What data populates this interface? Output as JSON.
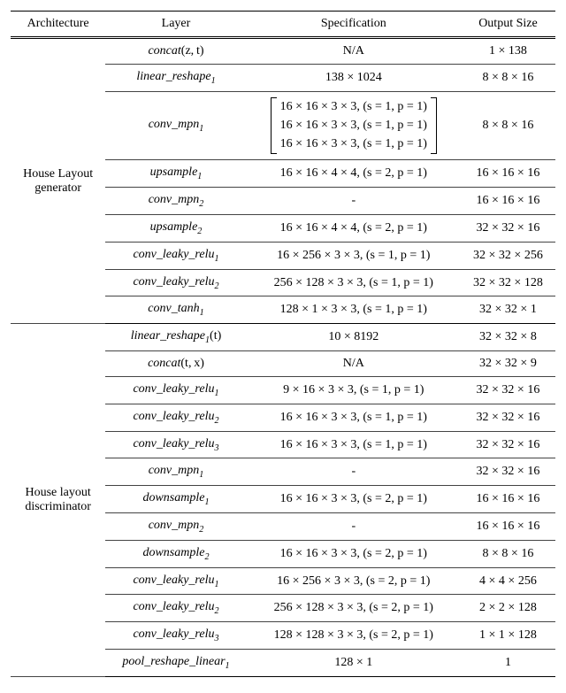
{
  "headers": {
    "arch": "Architecture",
    "layer": "Layer",
    "spec": "Specification",
    "out": "Output Size"
  },
  "sections": [
    {
      "arch": "House Layout\ngenerator",
      "rows": [
        {
          "layer_base": "concat",
          "layer_sub": "",
          "layer_args": "(z, t)",
          "spec": "N/A",
          "out": "1 × 138"
        },
        {
          "layer_base": "linear_reshape",
          "layer_sub": "1",
          "layer_args": "",
          "spec": "138 × 1024",
          "out": "8 × 8 × 16"
        },
        {
          "layer_base": "conv_mpn",
          "layer_sub": "1",
          "layer_args": "",
          "spec_bracket": [
            "16 × 16 × 3 × 3, (s = 1, p = 1)",
            "16 × 16 × 3 × 3, (s = 1, p = 1)",
            "16 × 16 × 3 × 3, (s = 1, p = 1)"
          ],
          "out": "8 × 8 × 16"
        },
        {
          "layer_base": "upsample",
          "layer_sub": "1",
          "layer_args": "",
          "spec": "16 × 16 × 4 × 4, (s = 2, p = 1)",
          "out": "16 × 16 × 16"
        },
        {
          "layer_base": "conv_mpn",
          "layer_sub": "2",
          "layer_args": "",
          "spec": "-",
          "out": "16 × 16 × 16"
        },
        {
          "layer_base": "upsample",
          "layer_sub": "2",
          "layer_args": "",
          "spec": "16 × 16 × 4 × 4, (s = 2, p = 1)",
          "out": "32 × 32 × 16"
        },
        {
          "layer_base": "conv_leaky_relu",
          "layer_sub": "1",
          "layer_args": "",
          "spec": "16 × 256 × 3 × 3, (s = 1, p = 1)",
          "out": "32 × 32 × 256"
        },
        {
          "layer_base": "conv_leaky_relu",
          "layer_sub": "2",
          "layer_args": "",
          "spec": "256 × 128 × 3 × 3, (s = 1, p = 1)",
          "out": "32 × 32 × 128"
        },
        {
          "layer_base": "conv_tanh",
          "layer_sub": "1",
          "layer_args": "",
          "spec": "128 × 1 × 3 × 3, (s = 1, p = 1)",
          "out": "32 × 32 × 1"
        }
      ]
    },
    {
      "arch": "House layout\ndiscriminator",
      "rows": [
        {
          "layer_base": "linear_reshape",
          "layer_sub": "1",
          "layer_args": "(t)",
          "spec": "10 × 8192",
          "out": "32 × 32 × 8"
        },
        {
          "layer_base": "concat",
          "layer_sub": "",
          "layer_args": "(t, x)",
          "spec": "N/A",
          "out": "32 × 32 × 9"
        },
        {
          "layer_base": "conv_leaky_relu",
          "layer_sub": "1",
          "layer_args": "",
          "spec": "9 × 16 × 3 × 3, (s = 1, p = 1)",
          "out": "32 × 32 × 16"
        },
        {
          "layer_base": "conv_leaky_relu",
          "layer_sub": "2",
          "layer_args": "",
          "spec": "16 × 16 × 3 × 3, (s = 1, p = 1)",
          "out": "32 × 32 × 16"
        },
        {
          "layer_base": "conv_leaky_relu",
          "layer_sub": "3",
          "layer_args": "",
          "spec": "16 × 16 × 3 × 3, (s = 1, p = 1)",
          "out": "32 × 32 × 16"
        },
        {
          "layer_base": "conv_mpn",
          "layer_sub": "1",
          "layer_args": "",
          "spec": "-",
          "out": "32 × 32 × 16"
        },
        {
          "layer_base": "downsample",
          "layer_sub": "1",
          "layer_args": "",
          "spec": "16 × 16 × 3 × 3, (s = 2, p = 1)",
          "out": "16 × 16 × 16"
        },
        {
          "layer_base": "conv_mpn",
          "layer_sub": "2",
          "layer_args": "",
          "spec": "-",
          "out": "16 × 16 × 16"
        },
        {
          "layer_base": "downsample",
          "layer_sub": "2",
          "layer_args": "",
          "spec": "16 × 16 × 3 × 3, (s = 2, p = 1)",
          "out": "8 × 8 × 16"
        },
        {
          "layer_base": "conv_leaky_relu",
          "layer_sub": "1",
          "layer_args": "",
          "spec": "16 × 256 × 3 × 3, (s = 2, p = 1)",
          "out": "4 × 4 × 256"
        },
        {
          "layer_base": "conv_leaky_relu",
          "layer_sub": "2",
          "layer_args": "",
          "spec": "256 × 128 × 3 × 3, (s = 2, p = 1)",
          "out": "2 × 2 × 128"
        },
        {
          "layer_base": "conv_leaky_relu",
          "layer_sub": "3",
          "layer_args": "",
          "spec": "128 × 128 × 3 × 3, (s = 2, p = 1)",
          "out": "1 × 1 × 128"
        },
        {
          "layer_base": "pool_reshape_linear",
          "layer_sub": "1",
          "layer_args": "",
          "spec": "128 × 1",
          "out": "1"
        }
      ]
    }
  ]
}
